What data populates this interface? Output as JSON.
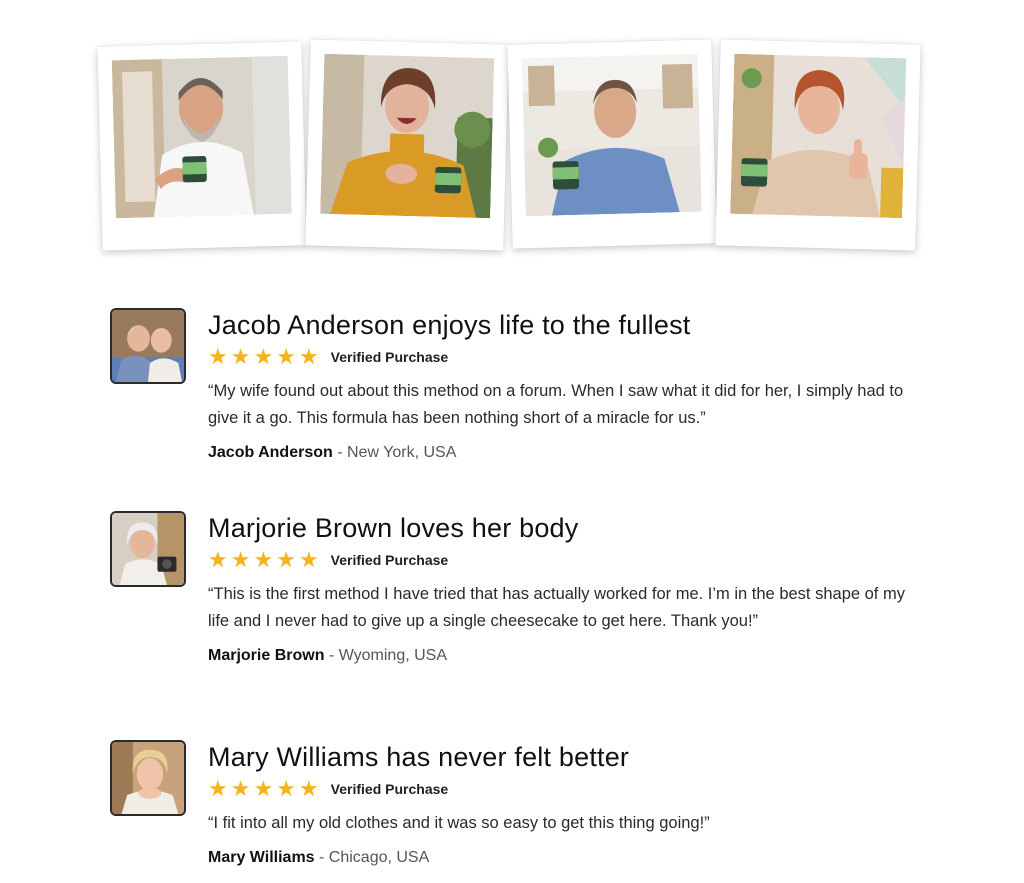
{
  "colors": {
    "star": "#f6b41b",
    "avatar_border": "#2b2b2b",
    "text": "#1a1a1a"
  },
  "polaroids": [
    {
      "subject": "man-white-tshirt-holding-jar"
    },
    {
      "subject": "woman-yellow-sweater-laughing"
    },
    {
      "subject": "man-blue-shirt-holding-jar"
    },
    {
      "subject": "woman-thumbs-up"
    }
  ],
  "reviews": [
    {
      "title": "Jacob Anderson enjoys life to the fullest",
      "rating": 5,
      "verified": "Verified Purchase",
      "quote": "“My wife found out about this method on a forum. When I saw what it did for her, I simply had to give it a go. This formula has been nothing short of a miracle for us.”",
      "author": "Jacob Anderson",
      "separator": " - ",
      "location": "New York, USA"
    },
    {
      "title": "Marjorie Brown loves her body",
      "rating": 5,
      "verified": "Verified Purchase",
      "quote": "“This is the first method I have tried that has actually worked for me. I’m in the best shape of my life and I never had to give up a single cheesecake to get here. Thank you!”",
      "author": "Marjorie Brown",
      "separator": " - ",
      "location": "Wyoming, USA"
    },
    {
      "title": "Mary Williams has never felt better",
      "rating": 5,
      "verified": "Verified Purchase",
      "quote": "“I fit into all my old clothes and it was so easy to get this thing going!”",
      "author": "Mary Williams",
      "separator": " - ",
      "location": "Chicago, USA"
    }
  ]
}
